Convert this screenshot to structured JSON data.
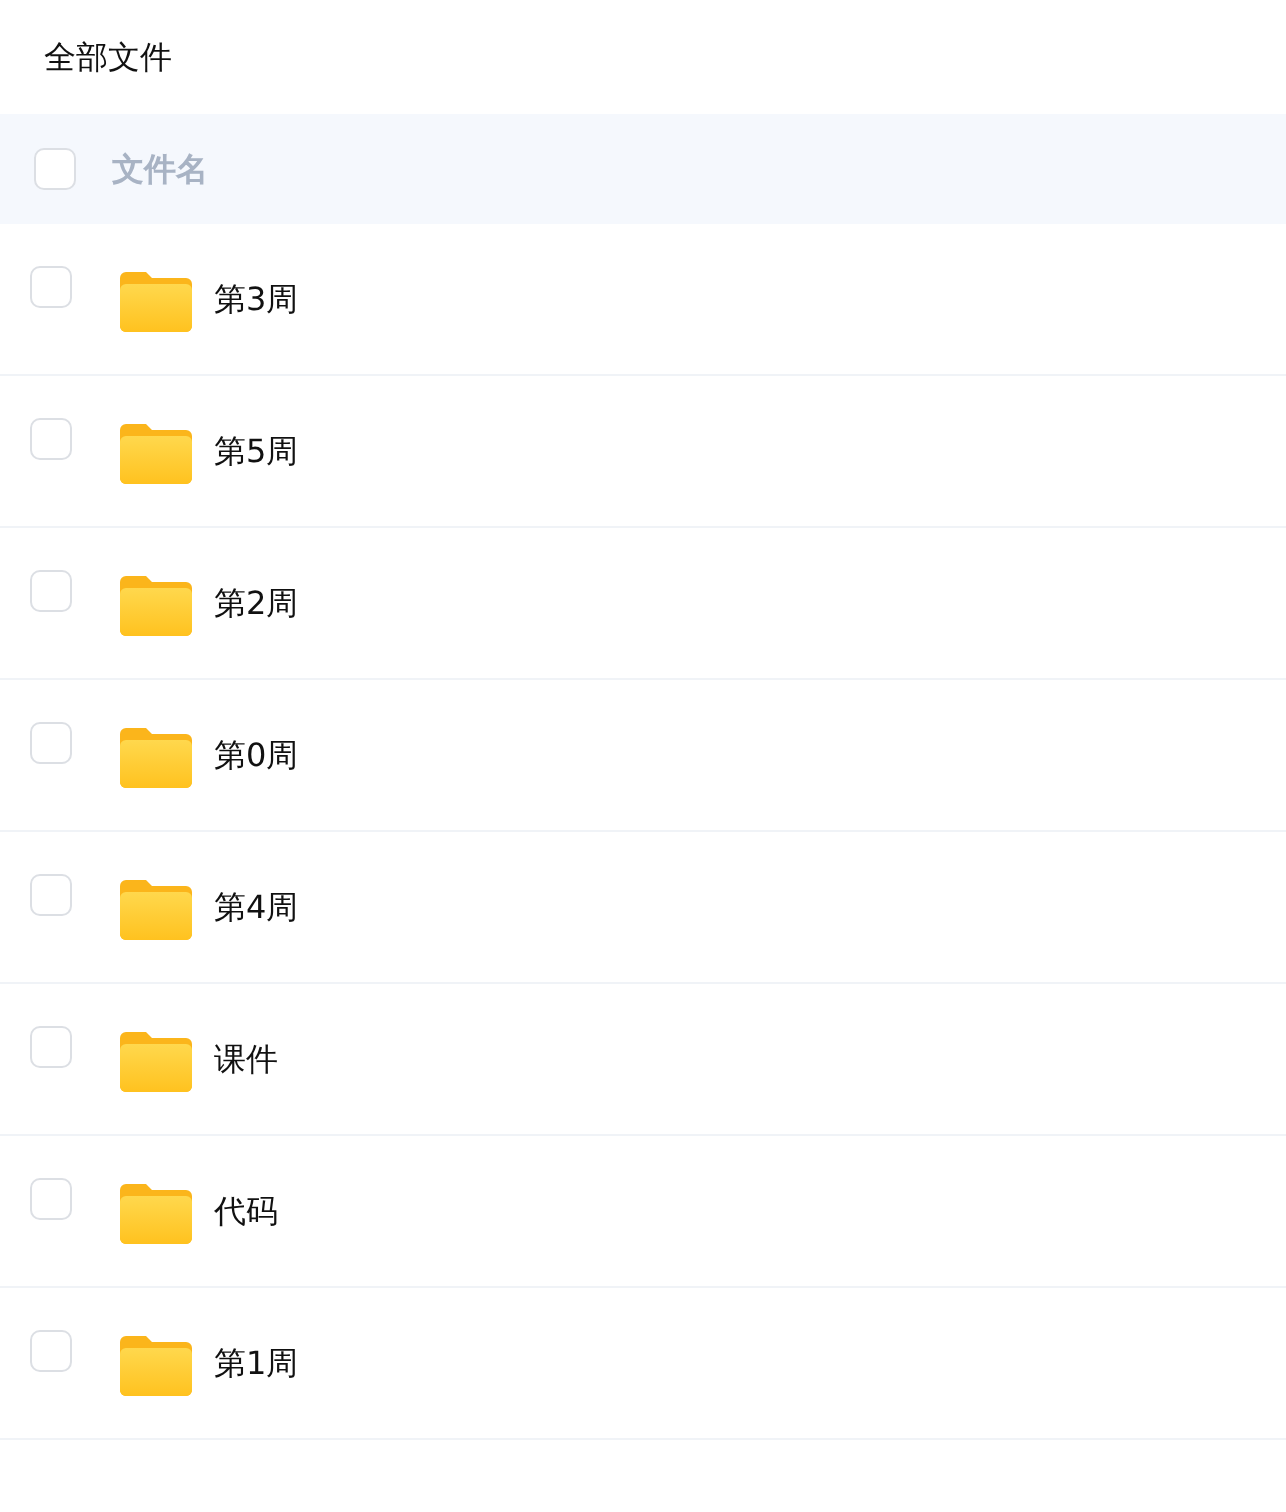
{
  "title": "全部文件",
  "header": {
    "checked": false,
    "column": "文件名"
  },
  "files": [
    {
      "name": "第3周",
      "kind": "folder",
      "checked": false
    },
    {
      "name": "第5周",
      "kind": "folder",
      "checked": false
    },
    {
      "name": "第2周",
      "kind": "folder",
      "checked": false
    },
    {
      "name": "第0周",
      "kind": "folder",
      "checked": false
    },
    {
      "name": "第4周",
      "kind": "folder",
      "checked": false
    },
    {
      "name": "课件",
      "kind": "folder",
      "checked": false
    },
    {
      "name": "代码",
      "kind": "folder",
      "checked": false
    },
    {
      "name": "第1周",
      "kind": "folder",
      "checked": false
    }
  ]
}
